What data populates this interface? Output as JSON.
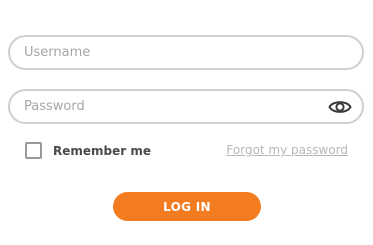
{
  "username": {
    "placeholder": "Username",
    "value": ""
  },
  "password": {
    "placeholder": "Password",
    "value": ""
  },
  "show_password_icon": "eye-icon",
  "remember": {
    "label": "Remember me",
    "checked": false
  },
  "forgot": {
    "label": "Forgot my password"
  },
  "login": {
    "label": "LOG IN"
  },
  "colors": {
    "accent": "#f47c20",
    "field_border": "#cfcfcf",
    "placeholder": "#a6a6a6",
    "link": "#b8b8b8"
  }
}
